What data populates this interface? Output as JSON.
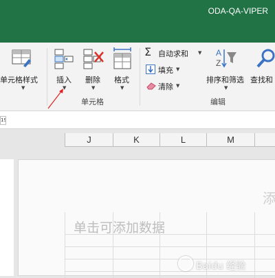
{
  "titlebar": {
    "user": "ODA-QA-VIPER",
    "color": "#217346"
  },
  "ribbon": {
    "cell_style_label": "单元格样式",
    "insert_label": "插入",
    "delete_label": "删除",
    "format_label": "格式",
    "cells_group_label": "单元格",
    "autosum_label": "自动求和",
    "fill_label": "填充",
    "clear_label": "清除",
    "sort_filter_label": "排序和筛选",
    "find_select_label": "查找和",
    "editing_group_label": "编辑"
  },
  "formula_bar": {
    "namebox": "19"
  },
  "columns": [
    "J",
    "K",
    "L",
    "M"
  ],
  "page": {
    "title_placeholder": "添",
    "data_placeholder": "单击可添加数据",
    "watermark": "Baidu 经验"
  },
  "colors": {
    "annotation_arrow": "#e02020",
    "delete_x": "#d9342b"
  }
}
